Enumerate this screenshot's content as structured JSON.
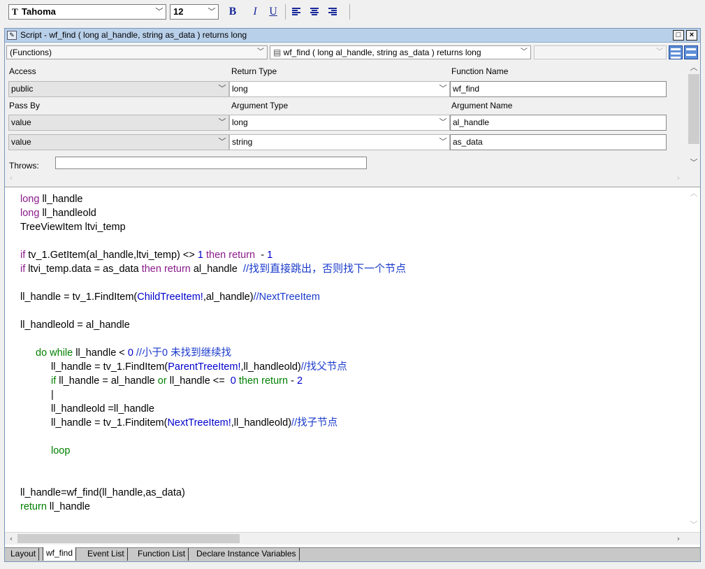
{
  "toolbar": {
    "font_name": "Tahoma",
    "font_size": "12",
    "bold_label": "B",
    "italic_label": "I",
    "underline_label": "U"
  },
  "window": {
    "title": "Script - wf_find ( long al_handle, string as_data )  returns long",
    "restore_label": "□",
    "close_label": "×"
  },
  "selectors": {
    "object": "(Functions)",
    "function": "wf_find ( long al_handle, string as_data )  returns long",
    "extra": ""
  },
  "properties": {
    "labels": {
      "access": "Access",
      "return_type": "Return Type",
      "function_name": "Function Name",
      "pass_by": "Pass By",
      "argument_type": "Argument Type",
      "argument_name": "Argument Name",
      "throws": "Throws:"
    },
    "access": "public",
    "return_type": "long",
    "function_name": "wf_find",
    "arguments": [
      {
        "pass_by": "value",
        "type": "long",
        "name": "al_handle"
      },
      {
        "pass_by": "value",
        "type": "string",
        "name": "as_data"
      }
    ],
    "throws": ""
  },
  "code": {
    "l1_kw": "long",
    "l1_rest": " ll_handle",
    "l2_kw": "long",
    "l2_rest": " ll_handleold",
    "l3": "TreeViewItem ltvi_temp",
    "l4_a": "if",
    "l4_b": " tv_1.GetItem(al_handle,ltvi_temp) <> ",
    "l4_c": "1",
    "l4_d": " then return",
    "l4_e": "  - ",
    "l4_f": "1",
    "l5_a": "if",
    "l5_b": " ltvi_temp.data = as_data ",
    "l5_c": "then return",
    "l5_d": " al_handle  ",
    "l5_e": "//找到直接跳出，否则找下一个节点",
    "l6_a": "ll_handle = tv_1.FindItem(",
    "l6_b": "ChildTreeItem!",
    "l6_c": ",al_handle)",
    "l6_d": "//NextTreeItem",
    "l7": "ll_handleold = al_handle",
    "l8_a": "do while",
    "l8_b": " ll_handle < ",
    "l8_c": "0",
    "l8_d": " //小于0 未找到继续找",
    "l9_a": "ll_handle = tv_1.FindItem(",
    "l9_b": "ParentTreeItem!",
    "l9_c": ",ll_handleold)",
    "l9_d": "//找父节点",
    "l10_a": "if",
    "l10_b": " ll_handle = al_handle ",
    "l10_c": "or",
    "l10_d": " ll_handle <=  ",
    "l10_e": "0",
    "l10_f": " then return",
    "l10_g": " - ",
    "l10_h": "2",
    "l11": "|",
    "l12": "ll_handleold =ll_handle",
    "l13_a": "ll_handle = tv_1.Finditem(",
    "l13_b": "NextTreeItem!",
    "l13_c": ",ll_handleold)",
    "l13_d": "//找子节点",
    "l14": "loop",
    "l15": "ll_handle=wf_find(ll_handle,as_data)",
    "l16_a": "return",
    "l16_b": " ll_handle"
  },
  "tabs": [
    "Layout",
    "wf_find",
    "Event List",
    "Function List",
    "Declare Instance Variables"
  ],
  "colors": {
    "title_bar": "#b9d0ea",
    "keyword": "#8a1a8a",
    "keyword_blue": "#0000cc",
    "keyword_green": "#008000",
    "comment": "#1a3acc"
  }
}
